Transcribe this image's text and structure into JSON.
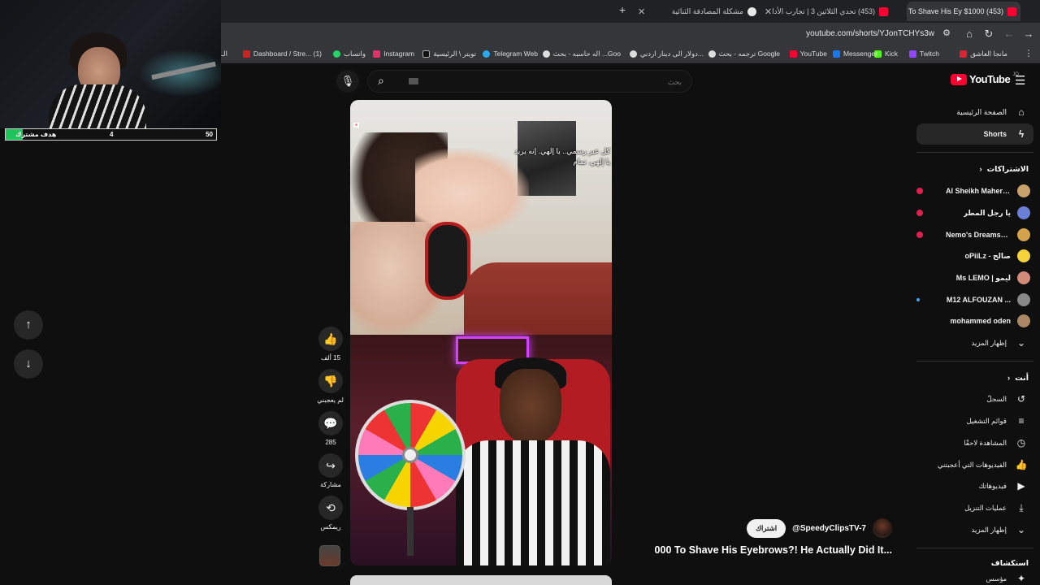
{
  "browser": {
    "tabs": [
      {
        "label": "(453) $1000 To Shave His Ey",
        "active": true
      },
      {
        "label": "(453) تحدي الثلاثين 3 | تجارب الأدا",
        "active": false
      },
      {
        "label": "مشكلة المصادقة الثنائية",
        "active": false
      }
    ],
    "url": "youtube.com/shorts/YJonTCHYs3w",
    "bookmarks": [
      {
        "label": "مانجا العاشق",
        "color": "#d23"
      },
      {
        "label": "Twitch",
        "color": "#9146ff"
      },
      {
        "label": "Kick",
        "color": "#53fc18"
      },
      {
        "label": "Messenger",
        "color": "#1877f2"
      },
      {
        "label": "YouTube",
        "color": "#ff0033"
      },
      {
        "label": "ترجمه - بحث Google",
        "color": "#ddd"
      },
      {
        "label": "دولار الى دينار اردني...",
        "color": "#ddd"
      },
      {
        "label": "اله حاسبه - بحث ...Goo",
        "color": "#ddd"
      },
      {
        "label": "Telegram Web",
        "color": "#2aabee"
      },
      {
        "label": "تويتر \\ الرئيسية",
        "color": "#111"
      },
      {
        "label": "Instagram",
        "color": "#e1306c"
      },
      {
        "label": "واتساب",
        "color": "#25d366"
      },
      {
        "label": "Dashboard / Stre... (1)",
        "color": "#c22"
      },
      {
        "label": "الـ",
        "color": "#ddd"
      }
    ]
  },
  "youtube": {
    "search_placeholder": "بحث",
    "logo_text": "YouTube",
    "logo_country": "JO"
  },
  "sidebar": {
    "home": "الصفحة الرئيسية",
    "shorts": "Shorts",
    "subscriptions_title": "الاشتراكات",
    "subscriptions": [
      {
        "name": "Al Sheikh Maher ...",
        "live": true,
        "color": "#c9a26b"
      },
      {
        "name": "يا رجل المطر",
        "live": true,
        "color": "#6b7fd6"
      },
      {
        "name": "Nemo's Dreamsc...",
        "live": true,
        "color": "#d4a24a"
      },
      {
        "name": "oPiiLz - صالح",
        "live": false,
        "color": "#f3d23a"
      },
      {
        "name": "Ms LEMO | ليمو",
        "live": false,
        "color": "#d28a7a"
      },
      {
        "name": "M12 ALFOUZAN ...",
        "live": false,
        "dot": true,
        "color": "#888"
      },
      {
        "name": "mohammed oden",
        "live": false,
        "color": "#aa8866"
      }
    ],
    "show_more": "إظهار المزيد",
    "you_title": "أنت",
    "you_items": [
      {
        "label": "السجلّ",
        "icon": "history-icon"
      },
      {
        "label": "قوائم التشغيل",
        "icon": "playlists-icon"
      },
      {
        "label": "المشاهدة لاحقًا",
        "icon": "watch-later-icon"
      },
      {
        "label": "الفيديوهات التي أعجبتني",
        "icon": "liked-videos-icon"
      },
      {
        "label": "فيديوهاتك",
        "icon": "your-videos-icon"
      },
      {
        "label": "عمليات التنزيل",
        "icon": "downloads-icon"
      },
      {
        "label": "إظهار المزيد",
        "icon": "chevron-down-icon"
      }
    ],
    "explore_title": "استكشاف",
    "explore_first": "مؤسس"
  },
  "short": {
    "subtitle_line1": "كل عبر رسمي.. يا إلهي. إنه يريد",
    "subtitle_line2": "يا إلهي.  تمام",
    "channel": "@SpeedyClipsTV-7",
    "subscribe": "اشتراك",
    "title": "000 To Shave His Eyebrows?! He Actually Did It...",
    "actions": {
      "like_count": "15 ألف",
      "dislike_label": "لم يعجبني",
      "comments_count": "285",
      "share_label": "مشاركة",
      "remix_label": "ريمكس"
    }
  },
  "overlay": {
    "goal_label": "هدف مشترك",
    "goal_current": "4",
    "goal_target": "50",
    "goal_progress": 0.08
  }
}
